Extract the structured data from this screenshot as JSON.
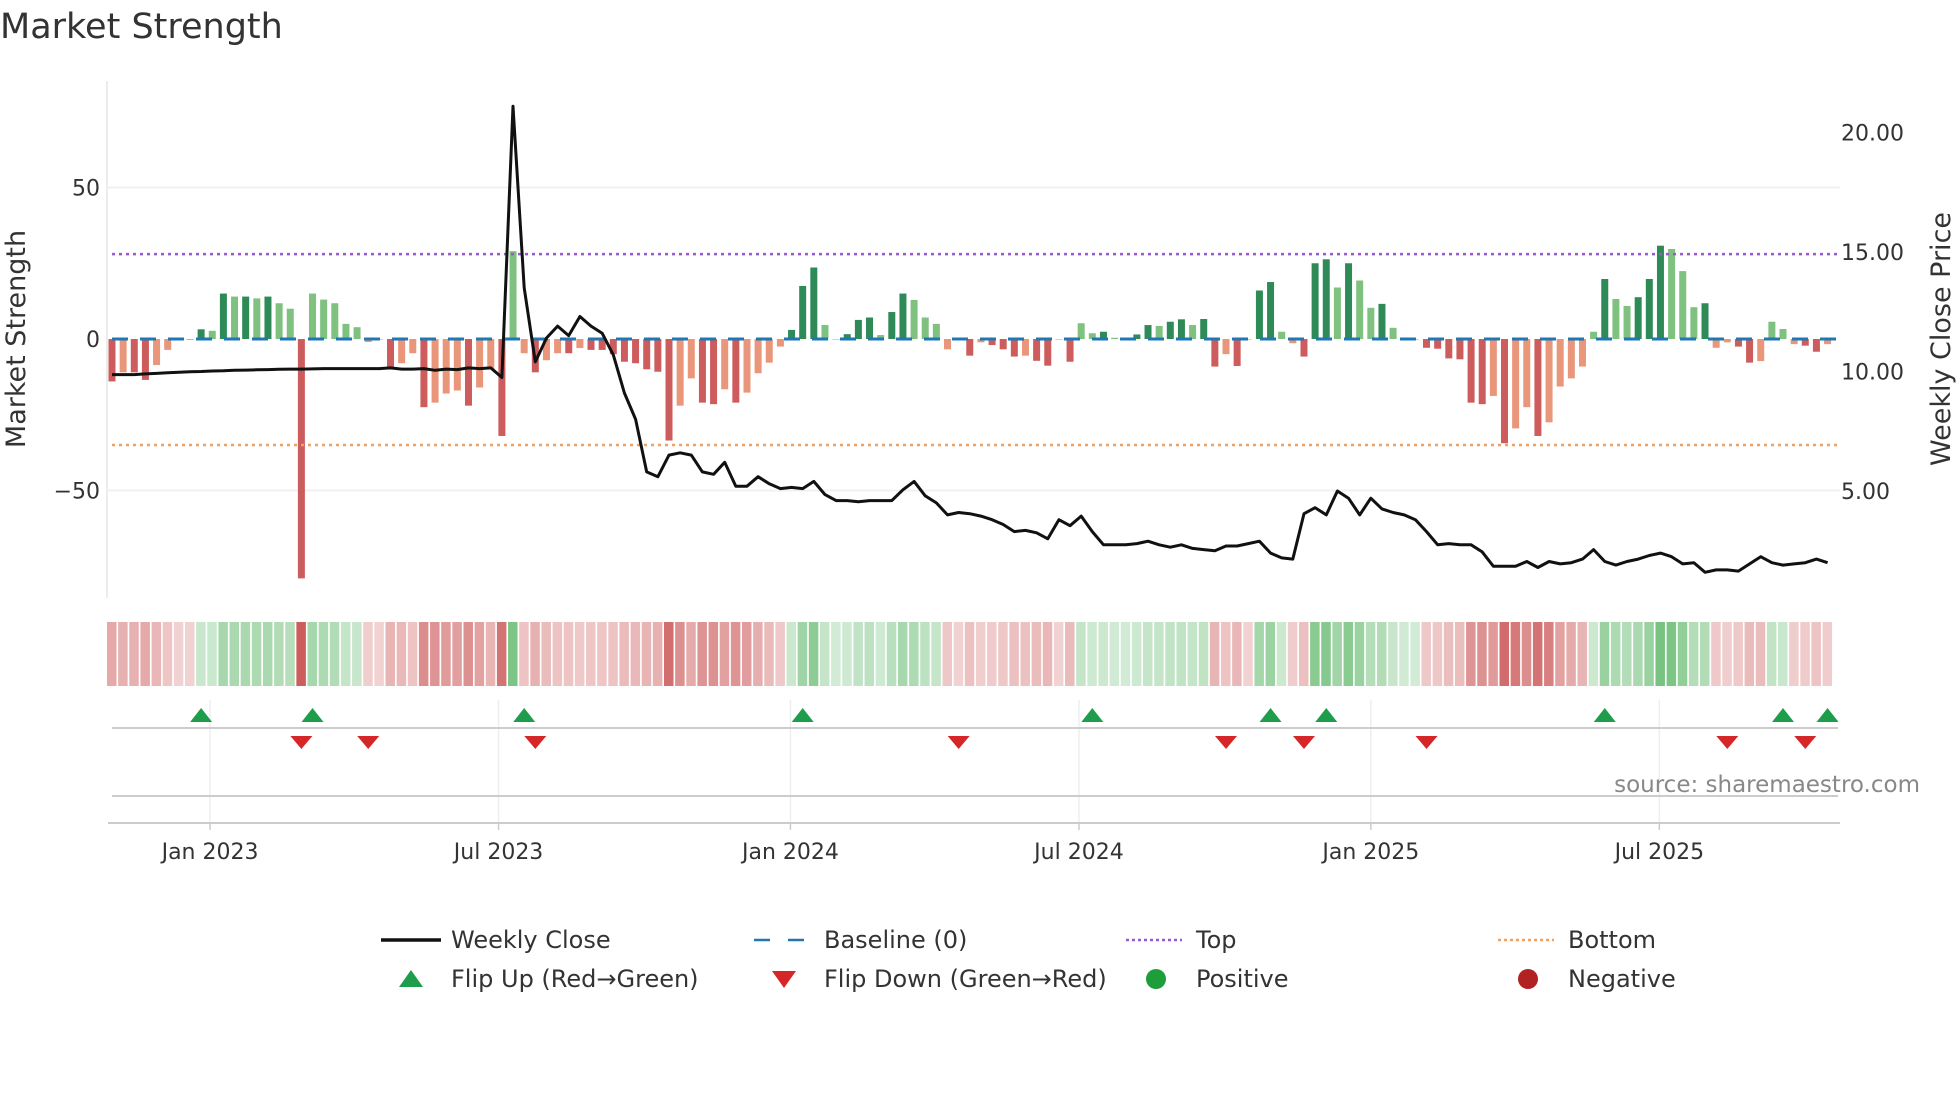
{
  "chart_data": {
    "type": "bar",
    "title": "Market Strength",
    "ylabel": "Market Strength",
    "ylabel_right": "Weekly Close Price",
    "source": "source: sharemaestro.com",
    "ylim": [
      -88,
      80
    ],
    "ylim_right": [
      0.5,
      22.5
    ],
    "yticks": [
      {
        "value": 50,
        "label": "50"
      },
      {
        "value": 0,
        "label": "0"
      },
      {
        "value": -50,
        "label": "−50"
      }
    ],
    "yticks_right": [
      {
        "value": 20,
        "label": "20.00"
      },
      {
        "value": 15,
        "label": "15.00"
      },
      {
        "value": 10,
        "label": "10.00"
      },
      {
        "value": 5,
        "label": "5.00"
      }
    ],
    "xticks": [
      {
        "week": 8.8,
        "label": "Jan 2023"
      },
      {
        "week": 34.7,
        "label": "Jul 2023"
      },
      {
        "week": 60.9,
        "label": "Jan 2024"
      },
      {
        "week": 86.8,
        "label": "Jul 2024"
      },
      {
        "week": 113,
        "label": "Jan 2025"
      },
      {
        "week": 138.9,
        "label": "Jul 2025"
      }
    ],
    "top_level": 28,
    "bottom_level": -35,
    "baseline": 0,
    "series": [
      {
        "name": "Market Strength",
        "values": [
          -14,
          -11,
          -11,
          -13.5,
          -8.6,
          -3.6,
          0,
          0,
          3.2,
          2.7,
          15,
          14,
          14,
          13.4,
          14,
          11.8,
          10,
          -79,
          15,
          13,
          11.8,
          5,
          3.9,
          -1,
          0,
          -10,
          -8,
          -4.7,
          -22.5,
          -21,
          -18,
          -17,
          -22,
          -16,
          -10,
          -32,
          29,
          -4.7,
          -11,
          -7,
          -4.7,
          -4.7,
          -3,
          -3.6,
          -3.6,
          -5,
          -7.5,
          -8,
          -10,
          -10.8,
          -33.5,
          -22,
          -13,
          -21,
          -21.5,
          -16.6,
          -21,
          -17.7,
          -11.3,
          -7.8,
          -2.5,
          3,
          17.5,
          23.6,
          4.6,
          0,
          1.6,
          6.3,
          7.1,
          1.3,
          8.9,
          15,
          12.9,
          7.1,
          5,
          -3.4,
          0,
          -5.5,
          -1.1,
          -2,
          -3.4,
          -5.8,
          -5.5,
          -7.2,
          -8.8,
          0,
          -7.5,
          5.2,
          1.9,
          2.4,
          0.4,
          0,
          1.5,
          4.6,
          4.3,
          5.7,
          6.5,
          4.6,
          6.6,
          -9.1,
          -5,
          -8.9,
          0,
          16,
          18.8,
          2.4,
          -1.4,
          -5.8,
          25,
          26.3,
          17,
          25,
          19.3,
          10.3,
          11.6,
          3.7,
          0.5,
          0,
          -2.9,
          -3.2,
          -6.4,
          -6.7,
          -21,
          -21.5,
          -18.8,
          -34.4,
          -29.5,
          -22.5,
          -32,
          -27.5,
          -15.7,
          -13,
          -9.1,
          2.4,
          19.8,
          13.2,
          10.9,
          13.8,
          19.8,
          30.8,
          29.7,
          22.4,
          10.5,
          11.8,
          -2.9,
          -1.1,
          -2.5,
          -7.8,
          -7.3,
          5.7,
          3.3,
          -1.7,
          -2.2,
          -4.2,
          -1.7
        ]
      },
      {
        "name": "Weekly Close",
        "values": [
          9.87,
          9.87,
          9.87,
          9.9,
          9.92,
          9.95,
          9.97,
          9.99,
          10.0,
          10.02,
          10.03,
          10.05,
          10.06,
          10.07,
          10.08,
          10.09,
          10.1,
          10.1,
          10.11,
          10.12,
          10.12,
          10.12,
          10.12,
          10.12,
          10.12,
          10.15,
          10.1,
          10.1,
          10.12,
          10.05,
          10.1,
          10.08,
          10.15,
          10.12,
          10.15,
          9.75,
          21.1,
          13.5,
          10.4,
          11.4,
          11.9,
          11.5,
          12.3,
          11.9,
          11.6,
          10.7,
          9.1,
          8.0,
          5.8,
          5.6,
          6.5,
          6.6,
          6.5,
          5.8,
          5.7,
          6.2,
          5.2,
          5.2,
          5.6,
          5.3,
          5.1,
          5.15,
          5.1,
          5.4,
          4.85,
          4.6,
          4.6,
          4.55,
          4.6,
          4.6,
          4.6,
          5.05,
          5.4,
          4.8,
          4.5,
          4.0,
          4.1,
          4.05,
          3.95,
          3.8,
          3.6,
          3.3,
          3.35,
          3.25,
          3.0,
          3.8,
          3.55,
          3.95,
          3.3,
          2.75,
          2.75,
          2.75,
          2.8,
          2.9,
          2.75,
          2.65,
          2.75,
          2.6,
          2.55,
          2.5,
          2.7,
          2.7,
          2.8,
          2.9,
          2.4,
          2.2,
          2.15,
          4.05,
          4.3,
          4.0,
          5.0,
          4.7,
          4.0,
          4.7,
          4.25,
          4.1,
          4.0,
          3.8,
          3.3,
          2.75,
          2.8,
          2.75,
          2.75,
          2.45,
          1.85,
          1.85,
          1.85,
          2.05,
          1.8,
          2.05,
          1.95,
          2.0,
          2.15,
          2.55,
          2.05,
          1.9,
          2.05,
          2.15,
          2.3,
          2.4,
          2.25,
          1.95,
          2.0,
          1.6,
          1.7,
          1.7,
          1.65,
          1.95,
          2.25,
          2.0,
          1.9,
          1.95,
          2.0,
          2.15,
          2.0
        ]
      }
    ],
    "flip_up_weeks": [
      8,
      18,
      37,
      62,
      88,
      104,
      109,
      134,
      150,
      154
    ],
    "flip_down_weeks": [
      17,
      23,
      38,
      76,
      100,
      107,
      118,
      145,
      152
    ],
    "legend": {
      "placement": "bottom",
      "items": [
        {
          "label": "Weekly Close",
          "kind": "line"
        },
        {
          "label": "Baseline (0)",
          "kind": "dash"
        },
        {
          "label": "Top",
          "kind": "dot-purple"
        },
        {
          "label": "Bottom",
          "kind": "dot-orange"
        },
        {
          "label": "Flip Up (Red→Green)",
          "kind": "tri-up"
        },
        {
          "label": "Flip Down (Green→Red)",
          "kind": "tri-down"
        },
        {
          "label": "Positive",
          "kind": "circle-green"
        },
        {
          "label": "Negative",
          "kind": "circle-red"
        }
      ]
    },
    "colors": {
      "pos_strong": "#2e8b57",
      "pos_weak": "#7fc17f",
      "neg_strong": "#cd5c5c",
      "neg_weak": "#e9967a",
      "baseline": "#1f77b4",
      "top": "#9b59d0",
      "bottom": "#f0a060",
      "line": "#111111",
      "flip_up": "#1e9e4a",
      "flip_down": "#d62728",
      "positive": "#1e9e3a",
      "negative": "#b22222"
    }
  }
}
